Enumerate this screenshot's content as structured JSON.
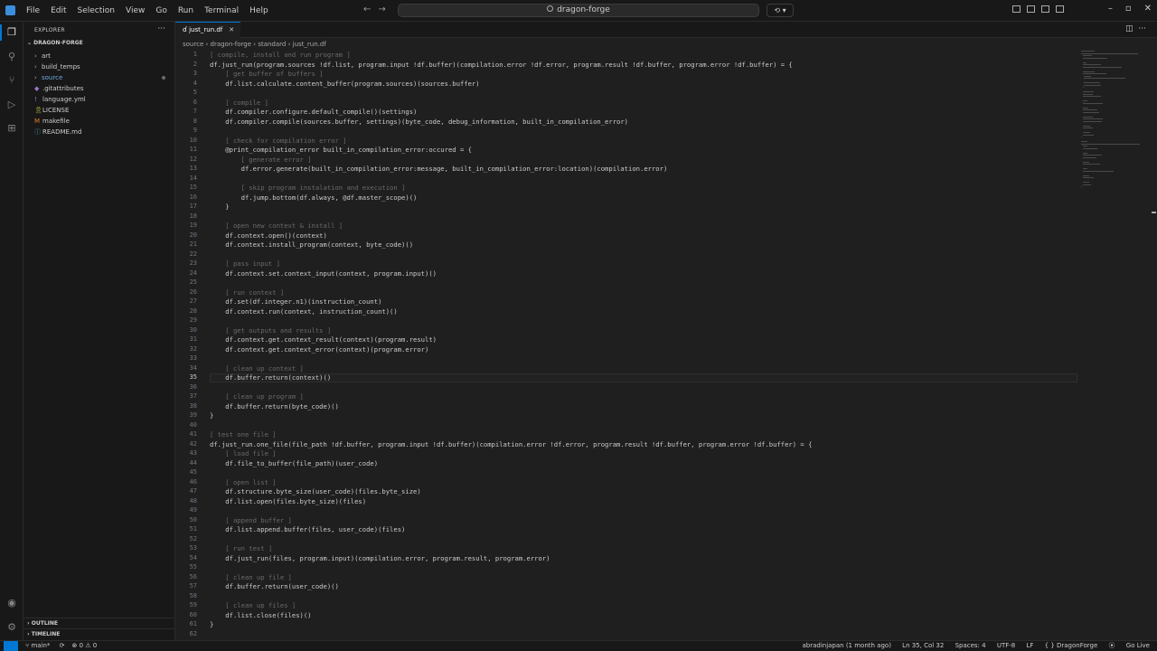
{
  "menu": [
    "File",
    "Edit",
    "Selection",
    "View",
    "Go",
    "Run",
    "Terminal",
    "Help"
  ],
  "search": {
    "text": "dragon-forge"
  },
  "explorer": {
    "title": "EXPLORER",
    "root": "DRAGON-FORGE",
    "items": [
      {
        "label": "art",
        "kind": "folder"
      },
      {
        "label": "build_temps",
        "kind": "folder"
      },
      {
        "label": "source",
        "kind": "folder",
        "modified": true
      },
      {
        "label": ".gitattributes",
        "kind": "file"
      },
      {
        "label": "language.yml",
        "kind": "file"
      },
      {
        "label": "LICENSE",
        "kind": "file"
      },
      {
        "label": "makefile",
        "kind": "file"
      },
      {
        "label": "README.md",
        "kind": "file"
      }
    ],
    "outline": "OUTLINE",
    "timeline": "TIMELINE"
  },
  "editor": {
    "tab": "just_run.df",
    "breadcrumb": [
      "source",
      "dragon-forge",
      "standard",
      "just_run.df"
    ],
    "current_line": 35,
    "lines": [
      "[ compile, install and run program ]",
      "df.just_run(program.sources !df.list, program.input !df.buffer)(compilation.error !df.error, program.result !df.buffer, program.error !df.buffer) = {",
      "    [ get buffer of buffers ]",
      "    df.list.calculate.content_buffer(program.sources)(sources.buffer)",
      "",
      "    [ compile ]",
      "    df.compiler.configure.default_compile()(settings)",
      "    df.compiler.compile(sources.buffer, settings)(byte_code, debug_information, built_in_compilation_error)",
      "",
      "    [ check for compilation error ]",
      "    @print_compilation_error built_in_compilation_error:occured = {",
      "        [ generate error ]",
      "        df.error.generate(built_in_compilation_error:message, built_in_compilation_error:location)(compilation.error)",
      "",
      "        [ skip program instalation and execution ]",
      "        df.jump.bottom(df.always, @df.master_scope)()",
      "    }",
      "",
      "    [ open new context & install ]",
      "    df.context.open()(context)",
      "    df.context.install_program(context, byte_code)()",
      "",
      "    [ pass input ]",
      "    df.context.set.context_input(context, program.input)()",
      "",
      "    [ run context ]",
      "    df.set(df.integer.n1)(instruction_count)",
      "    df.context.run(context, instruction_count)()",
      "",
      "    [ get outputs and results ]",
      "    df.context.get.context_result(context)(program.result)",
      "    df.context.get.context_error(context)(program.error)",
      "",
      "    [ clean up context ]",
      "    df.buffer.return(context)()",
      "",
      "    [ clean up program ]",
      "    df.buffer.return(byte_code)()",
      "}",
      "",
      "[ test one file ]",
      "df.just_run.one_file(file_path !df.buffer, program.input !df.buffer)(compilation.error !df.error, program.result !df.buffer, program.error !df.buffer) = {",
      "    [ load file ]",
      "    df.file_to_buffer(file_path)(user_code)",
      "",
      "    [ open list ]",
      "    df.structure.byte_size(user_code)(files.byte_size)",
      "    df.list.open(files.byte_size)(files)",
      "",
      "    [ append buffer ]",
      "    df.list.append.buffer(files, user_code)(files)",
      "",
      "    [ run test ]",
      "    df.just_run(files, program.input)(compilation.error, program.result, program.error)",
      "",
      "    [ clean up file ]",
      "    df.buffer.return(user_code)()",
      "",
      "    [ clean up files ]",
      "    df.list.close(files)()",
      "}",
      ""
    ]
  },
  "status": {
    "branch": "main*",
    "problems": "0 ⚠ 0",
    "blame": "abradinjapan (1 month ago)",
    "position": "Ln 35, Col 32",
    "spaces": "Spaces: 4",
    "encoding": "UTF-8",
    "eol": "LF",
    "language": "{ } DragonForge",
    "golive": "Go Live"
  }
}
